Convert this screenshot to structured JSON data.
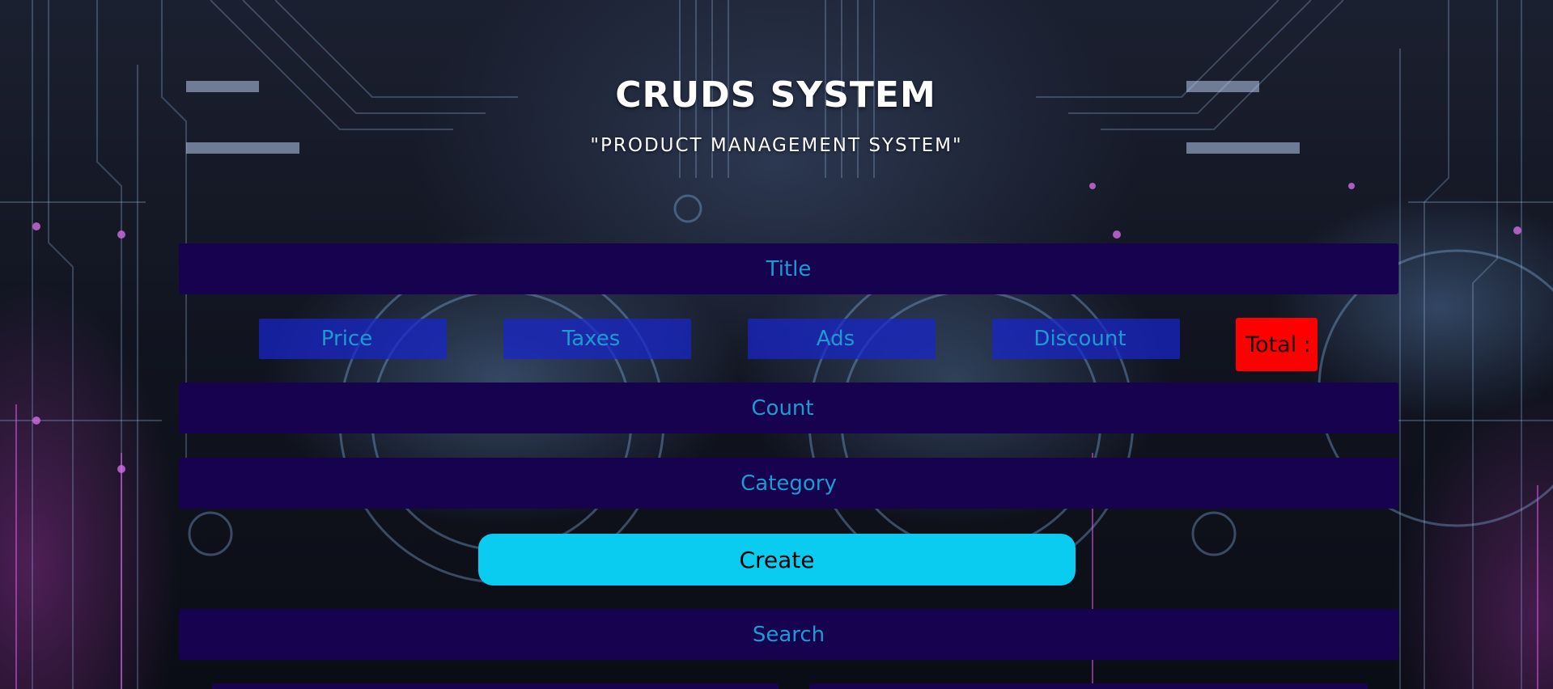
{
  "header": {
    "title": "CRUDS SYSTEM",
    "subtitle": "\"PRODUCT MANAGEMENT SYSTEM\""
  },
  "form": {
    "title_placeholder": "Title",
    "price_placeholder": "Price",
    "taxes_placeholder": "Taxes",
    "ads_placeholder": "Ads",
    "discount_placeholder": "Discount",
    "total_label": "Total :",
    "count_placeholder": "Count",
    "category_placeholder": "Category",
    "create_label": "Create",
    "search_placeholder": "Search"
  },
  "colors": {
    "input_bg": "#17024f",
    "input_text": "#1b9bd2",
    "small_input_bg": "#1826cd",
    "total_bg": "#ff0000",
    "create_bg": "#0acbf0"
  }
}
